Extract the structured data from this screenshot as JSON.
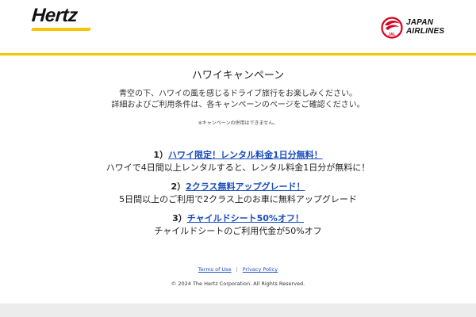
{
  "header": {
    "brand_left": "Hertz",
    "brand_right_line1": "JAPAN",
    "brand_right_line2": "AIRLINES",
    "brand_right_mark": "JAL",
    "accent_color": "#f7c600",
    "jal_red": "#d6001c"
  },
  "main": {
    "title": "ハワイキャンペーン",
    "intro_line1": "青空の下、ハワイの風を感じるドライブ旅行をお楽しみください。",
    "intro_line2": "詳細およびご利用条件は、各キャンペーンのページをご確認ください。",
    "note": "※キャンペーンの併用はできません。"
  },
  "campaigns": [
    {
      "number": "1）",
      "link": "ハワイ限定！レンタル料金1日分無料！",
      "description": "ハワイで4日間以上レンタルすると、レンタル料金1日分が無料に！"
    },
    {
      "number": "2）",
      "link": "2クラス無料アップグレード！",
      "description": "5日間以上のご利用で2クラス上のお車に無料アップグレード"
    },
    {
      "number": "3）",
      "link": "チャイルドシート50%オフ！",
      "description": "チャイルドシートのご利用代金が50%オフ"
    }
  ],
  "footer": {
    "terms_label": "Terms of Use",
    "separator": "|",
    "privacy_label": "Privacy Policy",
    "copyright": "© 2024 The Hertz Corporation. All Rights Reserved."
  }
}
